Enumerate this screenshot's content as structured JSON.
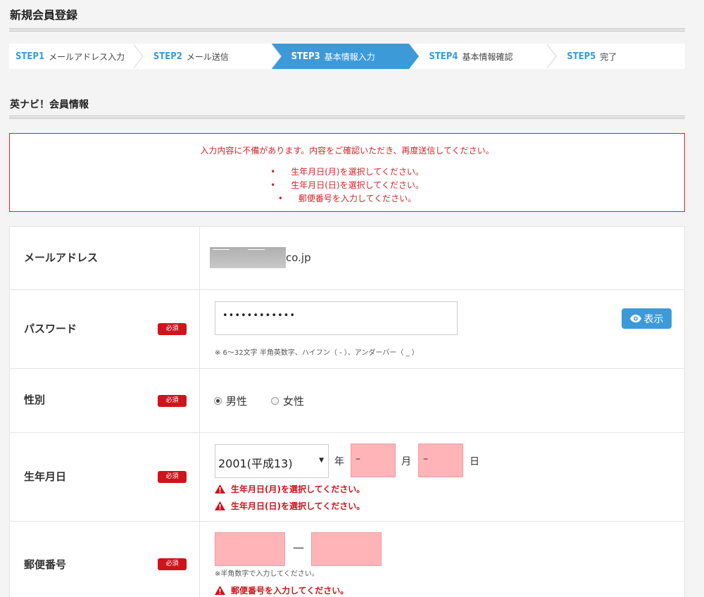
{
  "page": {
    "title": "新規会員登録"
  },
  "steps": [
    {
      "num": "STEP1",
      "label": "メールアドレス入力"
    },
    {
      "num": "STEP2",
      "label": "メール送信"
    },
    {
      "num": "STEP3",
      "label": "基本情報入力"
    },
    {
      "num": "STEP4",
      "label": "基本情報確認"
    },
    {
      "num": "STEP5",
      "label": "完了"
    }
  ],
  "section": {
    "title": "英ナビ！会員情報"
  },
  "errors": {
    "message": "入力内容に不備があります。内容をご確認いただき、再度送信してください。",
    "items": [
      "生年月日(月)を選択してください。",
      "生年月日(日)を選択してください。",
      "郵便番号を入力してください。"
    ]
  },
  "required_badge": "必須",
  "email": {
    "label": "メールアドレス",
    "visible_suffix": "co.jp"
  },
  "password": {
    "label": "パスワード",
    "value": "••••••••••••",
    "show_label": "表示",
    "hint": "※ 6～32文字 半角英数字、ハイフン（ - ）、アンダーバー（ _ ）"
  },
  "gender": {
    "label": "性別",
    "options": [
      "男性",
      "女性"
    ],
    "selected": "男性"
  },
  "birthday": {
    "label": "生年月日",
    "year_value": "2001(平成13)",
    "year_unit": "年",
    "month_value": "–",
    "month_unit": "月",
    "day_value": "–",
    "day_unit": "日",
    "errors": [
      "生年月日(月)を選択してください。",
      "生年月日(日)を選択してください。"
    ]
  },
  "postal": {
    "label": "郵便番号",
    "separator": "—",
    "hint": "※半角数字で入力してください。",
    "error": "郵便番号を入力してください。"
  },
  "colors": {
    "accent": "#3d9ad9",
    "error": "#d0262b",
    "invalid_field": "#ffb4b8"
  }
}
